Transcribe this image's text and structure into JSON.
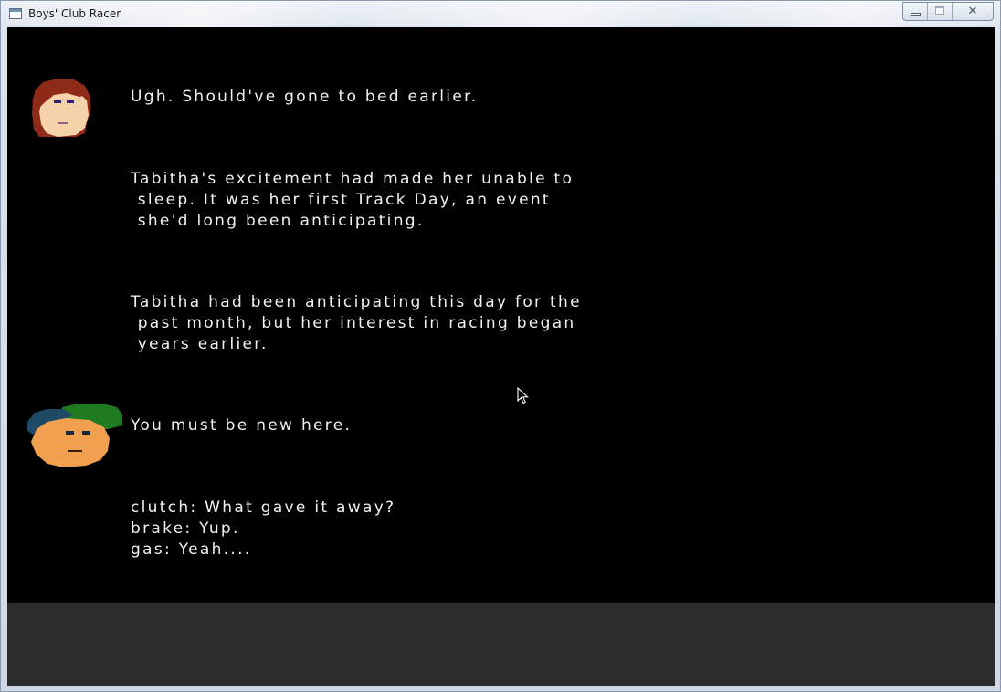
{
  "window": {
    "title": "Boys' Club Racer",
    "close_glyph": "✕"
  },
  "dialogue": [
    {
      "speaker_icon": "tabitha-portrait-icon",
      "lines": [
        "Ugh. Should've gone to bed earlier."
      ]
    },
    {
      "speaker_icon": null,
      "lines": [
        "Tabitha's excitement had made her unable to",
        " sleep. It was her first Track Day, an event",
        " she'd long been anticipating."
      ]
    },
    {
      "speaker_icon": null,
      "lines": [
        "Tabitha had been anticipating this day for the",
        " past month, but her interest in racing began",
        " years earlier."
      ]
    },
    {
      "speaker_icon": "cap-guy-portrait-icon",
      "lines": [
        "You must be new here."
      ]
    }
  ],
  "choices": [
    {
      "key": "clutch",
      "text": "clutch: What gave it away?"
    },
    {
      "key": "brake",
      "text": "brake: Yup."
    },
    {
      "key": "gas",
      "text": "gas: Yeah...."
    }
  ],
  "colors": {
    "game_background": "#000000",
    "text": "#f2f2f2",
    "bottom_panel": "#2c2c2c"
  }
}
